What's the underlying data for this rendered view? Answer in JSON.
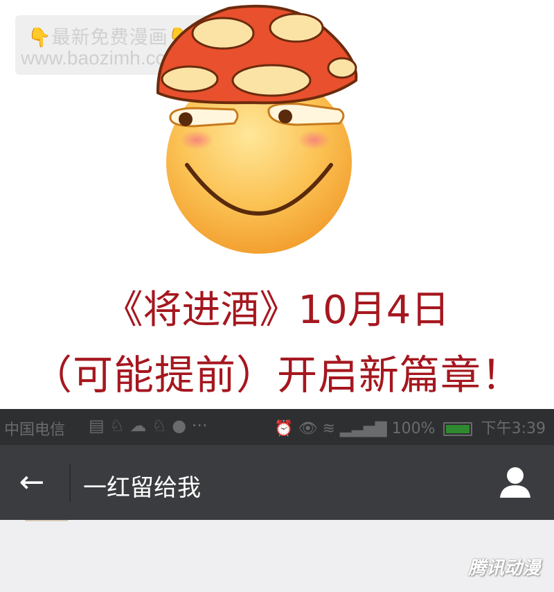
{
  "watermark": {
    "hand_left": "👇",
    "hand_right": "👇",
    "line1": "最新免费漫画",
    "line2": "www.baozimh.com"
  },
  "announcement": {
    "line1": "《将进酒》10月4日",
    "line2": "（可能提前）开启新篇章！"
  },
  "status_bar": {
    "carrier": "中国电信",
    "left_icons": "▤ ♘ ☁ ♘ ● ···",
    "right_icons": "⏰ 👁 ≋",
    "battery": "100%",
    "battery_level": 1.0,
    "time": "下午3:39"
  },
  "nav": {
    "back_icon": "←",
    "title": "一红留给我",
    "profile_icon": "person-icon"
  },
  "corner_watermark": "腾讯动漫",
  "colors": {
    "announce_red": "#a5171f",
    "status_bg": "#2e2f31",
    "nav_bg": "#3b3c3f",
    "content_bg": "#efeff1"
  }
}
